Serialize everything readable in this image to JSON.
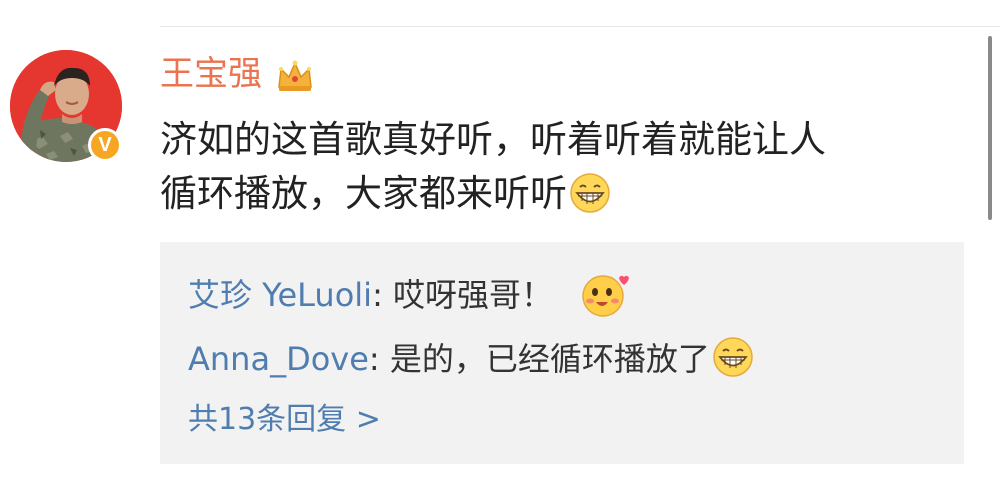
{
  "post": {
    "author": "王宝强",
    "author_badge_icon": "crown-icon",
    "verified_badge": "V",
    "text_line1": "济如的这首歌真好听，听着听着就能让人",
    "text_line2": "循环播放，大家都来听听",
    "text_emoji": "grin-emoji-icon"
  },
  "comments": [
    {
      "user": "艾珍 YeLuoli",
      "separator": ": ",
      "text": "哎呀强哥！",
      "emoji": "blush-emoji-icon"
    },
    {
      "user": "Anna_Dove",
      "separator": ": ",
      "text": "是的，已经循环播放了",
      "emoji": "grin-emoji-icon"
    }
  ],
  "more_replies": "共13条回复 >",
  "colors": {
    "author": "#eb7350",
    "link": "#507daf",
    "text": "#222222",
    "comment_bg": "#f2f2f2",
    "avatar_bg": "#e53730",
    "badge": "#f6a623"
  }
}
